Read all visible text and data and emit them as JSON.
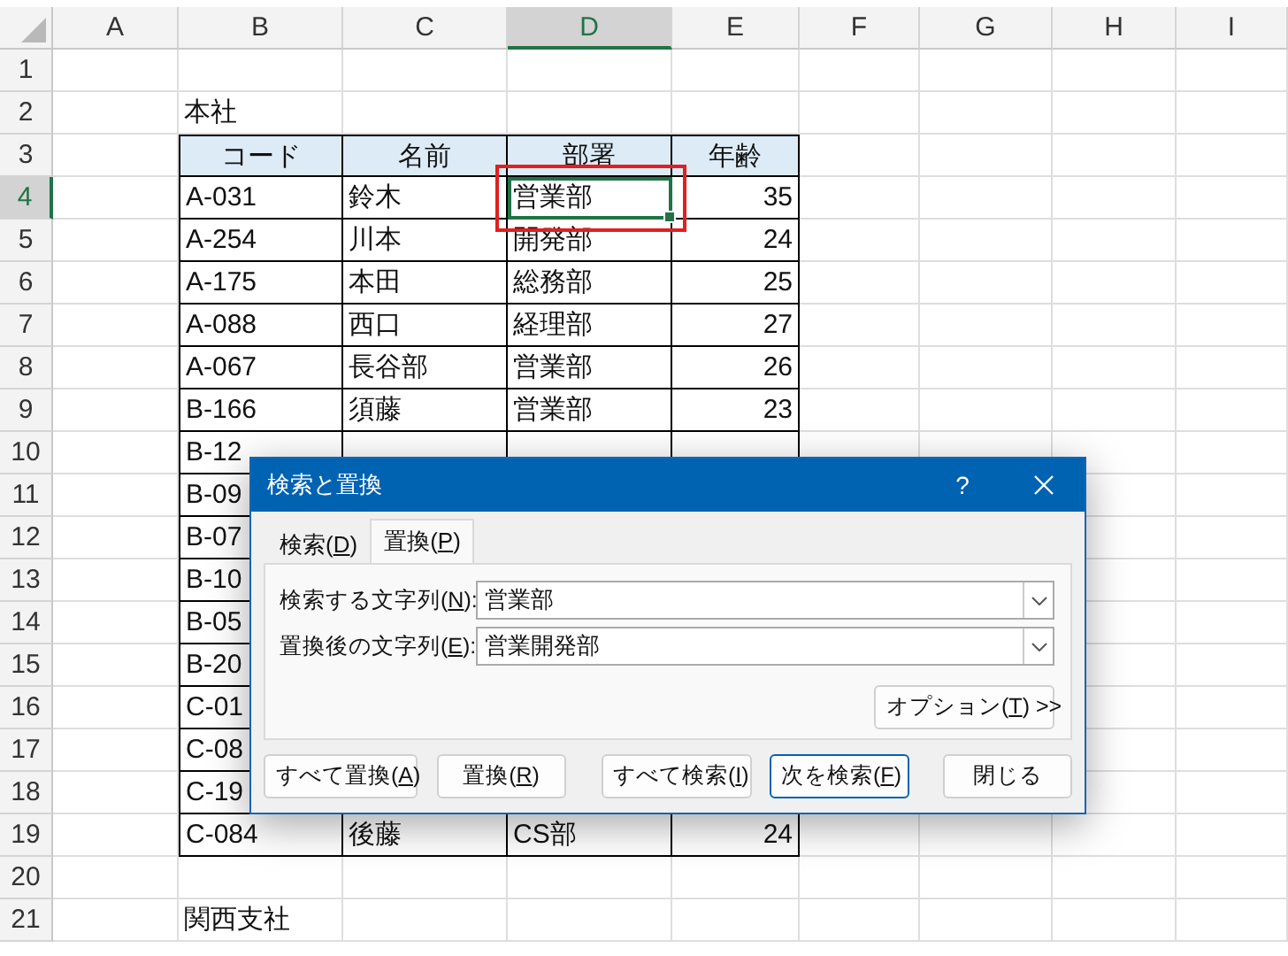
{
  "sheet": {
    "columns": [
      {
        "label": "A",
        "selected": false
      },
      {
        "label": "B",
        "selected": false
      },
      {
        "label": "C",
        "selected": false
      },
      {
        "label": "D",
        "selected": true
      },
      {
        "label": "E",
        "selected": false
      },
      {
        "label": "F",
        "selected": false
      },
      {
        "label": "G",
        "selected": false
      },
      {
        "label": "H",
        "selected": false
      },
      {
        "label": "I",
        "selected": false
      }
    ],
    "rows": [
      {
        "label": "1",
        "selected": false
      },
      {
        "label": "2",
        "selected": false
      },
      {
        "label": "3",
        "selected": false
      },
      {
        "label": "4",
        "selected": true
      },
      {
        "label": "5",
        "selected": false
      },
      {
        "label": "6",
        "selected": false
      },
      {
        "label": "7",
        "selected": false
      },
      {
        "label": "8",
        "selected": false
      },
      {
        "label": "9",
        "selected": false
      },
      {
        "label": "10",
        "selected": false
      },
      {
        "label": "11",
        "selected": false
      },
      {
        "label": "12",
        "selected": false
      },
      {
        "label": "13",
        "selected": false
      },
      {
        "label": "14",
        "selected": false
      },
      {
        "label": "15",
        "selected": false
      },
      {
        "label": "16",
        "selected": false
      },
      {
        "label": "17",
        "selected": false
      },
      {
        "label": "18",
        "selected": false
      },
      {
        "label": "19",
        "selected": false
      },
      {
        "label": "20",
        "selected": false
      },
      {
        "label": "21",
        "selected": false
      }
    ],
    "caption_1": "本社",
    "table": {
      "header": [
        "コード",
        "名前",
        "部署",
        "年齢"
      ],
      "rows": [
        {
          "cells": [
            {
              "text": "A-031",
              "selected": false,
              "highlighted": false
            },
            {
              "text": "鈴木",
              "selected": false,
              "highlighted": false
            },
            {
              "text": "営業部",
              "selected": true,
              "highlighted": true
            },
            {
              "text": "35",
              "selected": false,
              "highlighted": false
            }
          ]
        },
        {
          "cells": [
            {
              "text": "A-254",
              "selected": false,
              "highlighted": false
            },
            {
              "text": "川本",
              "selected": false,
              "highlighted": false
            },
            {
              "text": "開発部",
              "selected": false,
              "highlighted": false
            },
            {
              "text": "24",
              "selected": false,
              "highlighted": false
            }
          ]
        },
        {
          "cells": [
            {
              "text": "A-175",
              "selected": false,
              "highlighted": false
            },
            {
              "text": "本田",
              "selected": false,
              "highlighted": false
            },
            {
              "text": "総務部",
              "selected": false,
              "highlighted": false
            },
            {
              "text": "25",
              "selected": false,
              "highlighted": false
            }
          ]
        },
        {
          "cells": [
            {
              "text": "A-088",
              "selected": false,
              "highlighted": false
            },
            {
              "text": "西口",
              "selected": false,
              "highlighted": false
            },
            {
              "text": "経理部",
              "selected": false,
              "highlighted": false
            },
            {
              "text": "27",
              "selected": false,
              "highlighted": false
            }
          ]
        },
        {
          "cells": [
            {
              "text": "A-067",
              "selected": false,
              "highlighted": false
            },
            {
              "text": "長谷部",
              "selected": false,
              "highlighted": false
            },
            {
              "text": "営業部",
              "selected": false,
              "highlighted": false
            },
            {
              "text": "26",
              "selected": false,
              "highlighted": false
            }
          ]
        },
        {
          "cells": [
            {
              "text": "B-166",
              "selected": false,
              "highlighted": false
            },
            {
              "text": "須藤",
              "selected": false,
              "highlighted": false
            },
            {
              "text": "営業部",
              "selected": false,
              "highlighted": false
            },
            {
              "text": "23",
              "selected": false,
              "highlighted": false
            }
          ]
        },
        {
          "cells": [
            {
              "text": "B-12",
              "selected": false,
              "highlighted": false
            }
          ]
        },
        {
          "cells": [
            {
              "text": "B-09",
              "selected": false,
              "highlighted": false
            }
          ]
        },
        {
          "cells": [
            {
              "text": "B-07",
              "selected": false,
              "highlighted": false
            }
          ]
        },
        {
          "cells": [
            {
              "text": "B-10",
              "selected": false,
              "highlighted": false
            }
          ]
        },
        {
          "cells": [
            {
              "text": "B-05",
              "selected": false,
              "highlighted": false
            }
          ]
        },
        {
          "cells": [
            {
              "text": "B-20",
              "selected": false,
              "highlighted": false
            }
          ]
        },
        {
          "cells": [
            {
              "text": "C-01",
              "selected": false,
              "highlighted": false
            }
          ]
        },
        {
          "cells": [
            {
              "text": "C-08",
              "selected": false,
              "highlighted": false
            }
          ]
        },
        {
          "cells": [
            {
              "text": "C-19",
              "selected": false,
              "highlighted": false
            }
          ]
        },
        {
          "cells": [
            {
              "text": "C-084",
              "selected": false,
              "highlighted": false
            },
            {
              "text": "後藤",
              "selected": false,
              "highlighted": false
            },
            {
              "text": "CS部",
              "selected": false,
              "highlighted": false
            },
            {
              "text": "24",
              "selected": false,
              "highlighted": false
            }
          ]
        }
      ]
    },
    "caption_2": "関西支社"
  },
  "dialog": {
    "title": "検索と置換",
    "help": "?",
    "tabs": [
      {
        "label": [
          "検索(",
          "D",
          ")"
        ],
        "selected": false
      },
      {
        "label": [
          "置換(",
          "P",
          ")"
        ],
        "selected": true
      }
    ],
    "fields": [
      {
        "label": [
          "検索する文字列(",
          "N",
          "):"
        ],
        "value": "営業部"
      },
      {
        "label": [
          "置換後の文字列(",
          "E",
          "):"
        ],
        "value": "営業開発部"
      }
    ],
    "options_button": [
      "オプション(",
      "T",
      ") >>"
    ],
    "buttons": [
      {
        "label": [
          "すべて置換(",
          "A",
          ")"
        ],
        "default": false
      },
      {
        "label": [
          "置換(",
          "R",
          ")"
        ],
        "default": false
      },
      {
        "label": [
          "すべて検索(",
          "I",
          ")"
        ],
        "default": false
      },
      {
        "label": [
          "次を検索(",
          "F",
          ")"
        ],
        "default": true
      },
      {
        "label": [
          "閉じる"
        ],
        "default": false
      }
    ]
  }
}
